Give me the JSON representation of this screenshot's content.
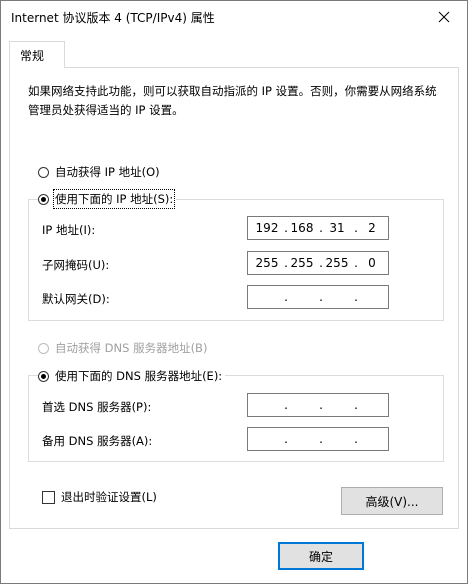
{
  "window": {
    "title": "Internet 协议版本 4 (TCP/IPv4) 属性"
  },
  "tabs": [
    {
      "label": "常规"
    }
  ],
  "description": "如果网络支持此功能，则可以获取自动指派的 IP 设置。否则，你需要从网络系统管理员处获得适当的 IP 设置。",
  "ip_mode": {
    "auto_label": "自动获得 IP 地址(O)",
    "manual_label": "使用下面的 IP 地址(S):",
    "selected": "manual"
  },
  "ip_fields": [
    {
      "label": "IP 地址(I):",
      "octets": [
        "192",
        "168",
        "31",
        "2"
      ]
    },
    {
      "label": "子网掩码(U):",
      "octets": [
        "255",
        "255",
        "255",
        "0"
      ]
    },
    {
      "label": "默认网关(D):",
      "octets": [
        "",
        "",
        "",
        ""
      ]
    }
  ],
  "dns_mode": {
    "auto_label": "自动获得 DNS 服务器地址(B)",
    "manual_label": "使用下面的 DNS 服务器地址(E):",
    "selected": "manual"
  },
  "dns_fields": [
    {
      "label": "首选 DNS 服务器(P):",
      "octets": [
        "",
        "",
        "",
        ""
      ]
    },
    {
      "label": "备用 DNS 服务器(A):",
      "octets": [
        "",
        "",
        "",
        ""
      ]
    }
  ],
  "validate_on_exit": {
    "label": "退出时验证设置(L)",
    "checked": false
  },
  "buttons": {
    "advanced": "高级(V)...",
    "ok": "确定"
  },
  "colors": {
    "focus_border": "#0078d7",
    "button_bg": "#e1e1e1",
    "disabled_text": "#a0a0a0"
  }
}
